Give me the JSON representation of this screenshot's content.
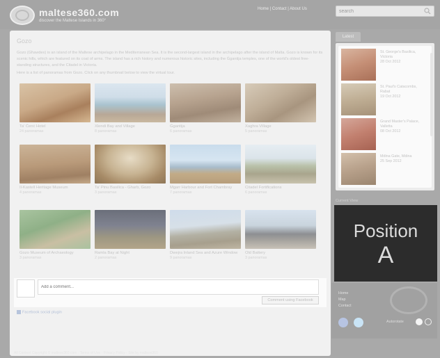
{
  "header": {
    "logo_text": "maltese360.com",
    "tagline": "discover the Maltese Islands in 360°",
    "top_links": "Home  |  Contact  |  About Us",
    "search_value": "search"
  },
  "main": {
    "title": "Gozo",
    "intro": "Gozo (Għawdex) is an island of the Maltese archipelago in the Mediterranean Sea. It is the second-largest island in the archipelago after the island of Malta. Gozo is known for its scenic hills, which are featured on its coat of arms. The island has a rich history and numerous historic sites, including the Ġgantija temples, one of the world's oldest free-standing structures, and the Citadel in Victoria.",
    "intro2": "Here is a list of panoramas from Gozo. Click on any thumbnail below to view the virtual tour.",
    "cards": [
      {
        "title": "Ta' Ċenċ Hotel",
        "meta": "24 panoramas"
      },
      {
        "title": "Xlendi Bay and Village",
        "meta": "8 panoramas"
      },
      {
        "title": "Ġgantija",
        "meta": "6 panoramas"
      },
      {
        "title": "Xaghra Village",
        "meta": "5 panoramas"
      },
      {
        "title": "Il-Kastell Heritage Museum",
        "meta": "4 panoramas"
      },
      {
        "title": "Ta' Pinu Basilica - Gharb, Gozo",
        "meta": "3 panoramas"
      },
      {
        "title": "Mgarr Harbour and Fort Chambray",
        "meta": "7 panoramas"
      },
      {
        "title": "Citadel Fortifications",
        "meta": "6 panoramas"
      },
      {
        "title": "Gozo Museum of Archaeology",
        "meta": "3 panoramas"
      },
      {
        "title": "Ramla Bay at Night",
        "meta": "2 panoramas"
      },
      {
        "title": "Dwejra Inland Sea and Azure Window",
        "meta": "9 panoramas"
      },
      {
        "title": "Old Battery",
        "meta": "3 panoramas"
      }
    ],
    "comment_placeholder": "Add a comment...",
    "comment_button": "Comment using Facebook",
    "fb_plugin": "Facebook social plugin",
    "footer": "All Content Copyright © maltese360.com · Terms of Use · Privacy Policy · Site by maltese360"
  },
  "sidebar": {
    "tab": "Latest",
    "items": [
      {
        "title": "St. George's Basilica, Victoria",
        "meta": "28 Oct 2012"
      },
      {
        "title": "St. Paul's Catacombs, Rabat",
        "meta": "19 Oct 2012"
      },
      {
        "title": "Grand Master's Palace, Valletta",
        "meta": "08 Oct 2012"
      },
      {
        "title": "Mdina Gate, Mdina",
        "meta": "25 Sep 2012"
      }
    ],
    "position_label": "Current View",
    "position_word": "Position",
    "position_letter": "A",
    "links": [
      "Home",
      "Map",
      "Contact"
    ],
    "toggle_label": "Autorotate"
  },
  "colors": {
    "facebook": "#b7c4e2",
    "twitter": "#c9e4f6"
  }
}
